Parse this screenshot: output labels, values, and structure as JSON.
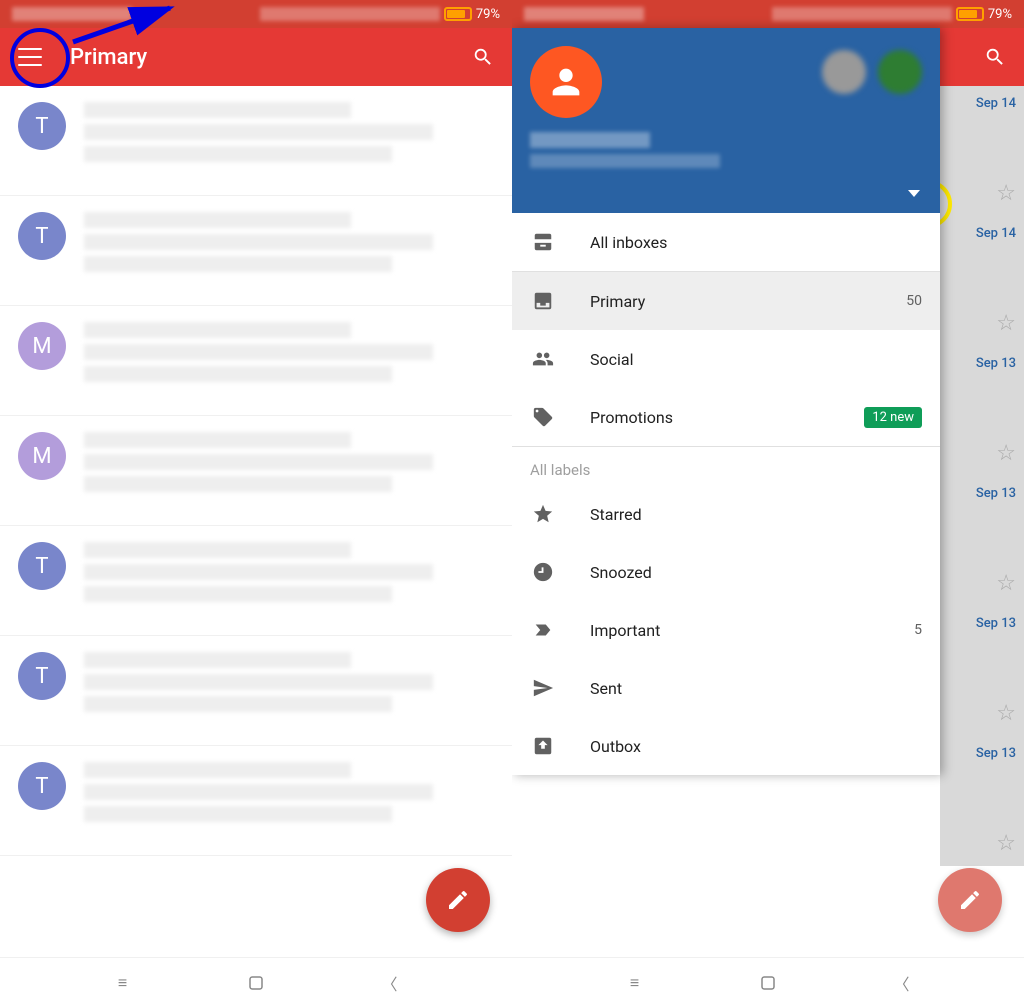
{
  "statusbar": {
    "battery_pct": "79%"
  },
  "left": {
    "title": "Primary",
    "emails": [
      {
        "avatar": "T",
        "color": "t"
      },
      {
        "avatar": "T",
        "color": "t"
      },
      {
        "avatar": "M",
        "color": "m"
      },
      {
        "avatar": "M",
        "color": "m"
      },
      {
        "avatar": "T",
        "color": "t"
      },
      {
        "avatar": "T",
        "color": "t"
      },
      {
        "avatar": "T",
        "color": "t"
      }
    ]
  },
  "drawer": {
    "all_inboxes": "All inboxes",
    "categories": [
      {
        "label": "Primary",
        "count": "50",
        "badge": "",
        "selected": true
      },
      {
        "label": "Social",
        "count": "",
        "badge": "",
        "selected": false
      },
      {
        "label": "Promotions",
        "count": "",
        "badge": "12 new",
        "selected": false
      }
    ],
    "section_label": "All labels",
    "labels": [
      {
        "label": "Starred",
        "count": ""
      },
      {
        "label": "Snoozed",
        "count": ""
      },
      {
        "label": "Important",
        "count": "5"
      },
      {
        "label": "Sent",
        "count": ""
      },
      {
        "label": "Outbox",
        "count": ""
      }
    ]
  },
  "bg_dates": [
    "Sep 14",
    "Sep 14",
    "Sep 13",
    "Sep 13",
    "Sep 13",
    "Sep 13"
  ]
}
